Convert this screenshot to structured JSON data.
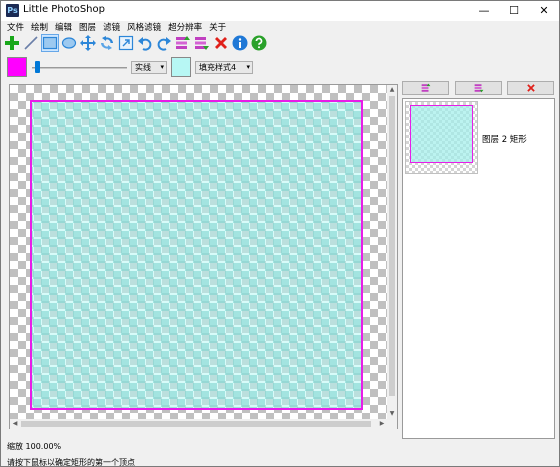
{
  "window": {
    "title": "Little PhotoShop",
    "app_icon_text": "Ps",
    "minimize_glyph": "—",
    "maximize_glyph": "☐",
    "close_glyph": "✕"
  },
  "menu": [
    "文件",
    "绘制",
    "编辑",
    "图层",
    "滤镜",
    "风格滤镜",
    "超分辨率",
    "关于"
  ],
  "toolbar": {
    "tools": [
      {
        "icon": "plus-icon",
        "color": "#19a71a"
      },
      {
        "icon": "line-icon",
        "color": "#6a7fa8"
      },
      {
        "icon": "rectangle-icon",
        "color": "#2c86d8",
        "active": true
      },
      {
        "icon": "ellipse-icon",
        "color": "#2c86d8"
      },
      {
        "icon": "move-icon",
        "color": "#2c86d8"
      },
      {
        "icon": "rotate-icon",
        "color": "#2c86d8"
      },
      {
        "icon": "resize-icon",
        "color": "#2c86d8"
      },
      {
        "icon": "undo-icon",
        "color": "#2c86d8"
      },
      {
        "icon": "redo-icon",
        "color": "#2c86d8"
      },
      {
        "icon": "layer-up-icon",
        "color": "#c040c0"
      },
      {
        "icon": "layer-down-icon",
        "color": "#c040c0"
      },
      {
        "icon": "delete-icon",
        "color": "#e0201a"
      },
      {
        "icon": "info-icon",
        "color": "#1f78d6"
      },
      {
        "icon": "help-icon",
        "color": "#2aa12a"
      }
    ]
  },
  "options": {
    "stroke_color": "#ff00ff",
    "fill_color": "#b7f7f4",
    "line_width_fraction": 0.03,
    "line_style": "实线",
    "fill_style": "填充样式4"
  },
  "canvas": {
    "shape_stroke": "#e81ce8",
    "shape_fill": "#b7f7f4"
  },
  "layers": {
    "buttons": [
      {
        "icon": "layer-up-icon"
      },
      {
        "icon": "layer-down-icon"
      },
      {
        "icon": "delete-layer-icon"
      }
    ],
    "items": [
      {
        "name": "图层 2 矩形"
      }
    ]
  },
  "status": {
    "zoom": "缩放 100.00%",
    "message": "请按下鼠标以确定矩形的第一个顶点"
  }
}
